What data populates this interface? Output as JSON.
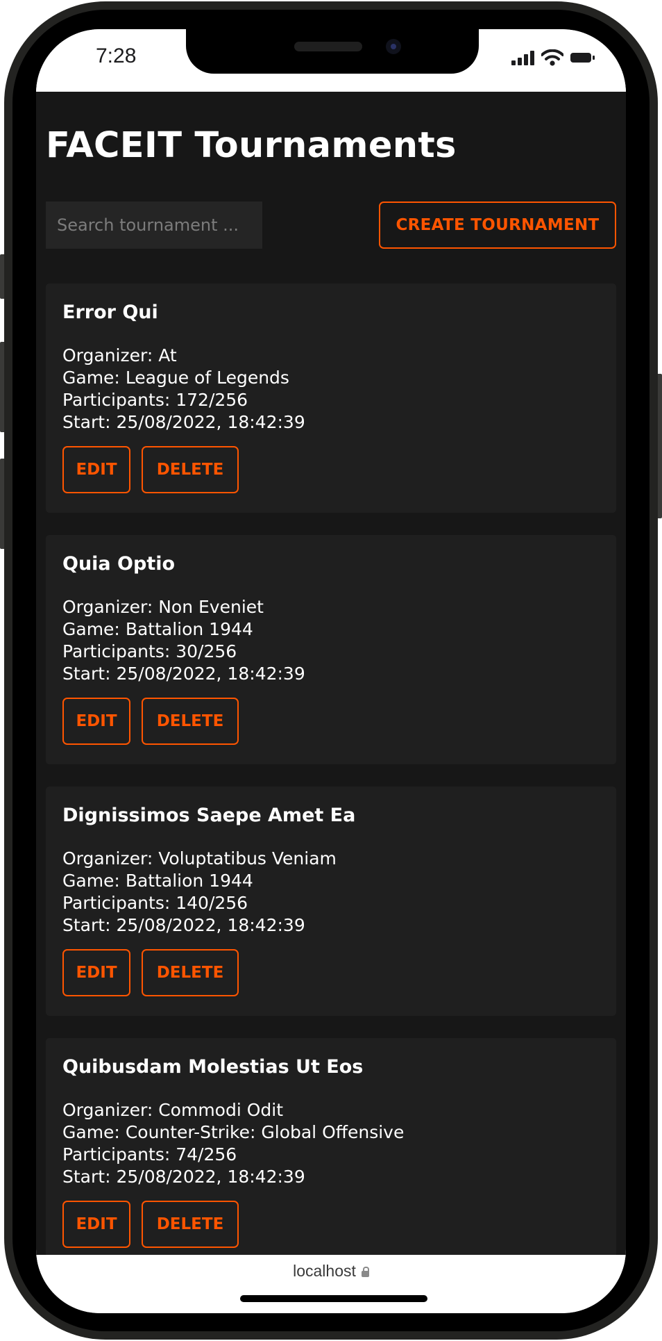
{
  "status_bar": {
    "time": "7:28"
  },
  "app": {
    "title": "FACEIT Tournaments",
    "search": {
      "placeholder": "Search tournament ...",
      "value": ""
    },
    "create_button_label": "CREATE TOURNAMENT",
    "labels": {
      "organizer": "Organizer:",
      "game": "Game:",
      "participants": "Participants:",
      "start": "Start:"
    },
    "edit_label": "EDIT",
    "delete_label": "DELETE",
    "tournaments": [
      {
        "name": "Error Qui",
        "organizer": "At",
        "game": "League of Legends",
        "participants": "172/256",
        "start": "25/08/2022, 18:42:39"
      },
      {
        "name": "Quia Optio",
        "organizer": "Non Eveniet",
        "game": "Battalion 1944",
        "participants": "30/256",
        "start": "25/08/2022, 18:42:39"
      },
      {
        "name": "Dignissimos Saepe Amet Ea",
        "organizer": "Voluptatibus Veniam",
        "game": "Battalion 1944",
        "participants": "140/256",
        "start": "25/08/2022, 18:42:39"
      },
      {
        "name": "Quibusdam Molestias Ut Eos",
        "organizer": "Commodi Odit",
        "game": "Counter-Strike: Global Offensive",
        "participants": "74/256",
        "start": "25/08/2022, 18:42:39"
      }
    ]
  },
  "browser": {
    "url": "localhost"
  },
  "theme": {
    "accent": "#ff5500",
    "background": "#171717",
    "card": "#1f1f1f",
    "input": "#252525",
    "text": "#ffffff"
  },
  "icons": {
    "signal": "signal-icon",
    "wifi": "wifi-icon",
    "battery": "battery-icon",
    "lock": "lock-icon"
  }
}
